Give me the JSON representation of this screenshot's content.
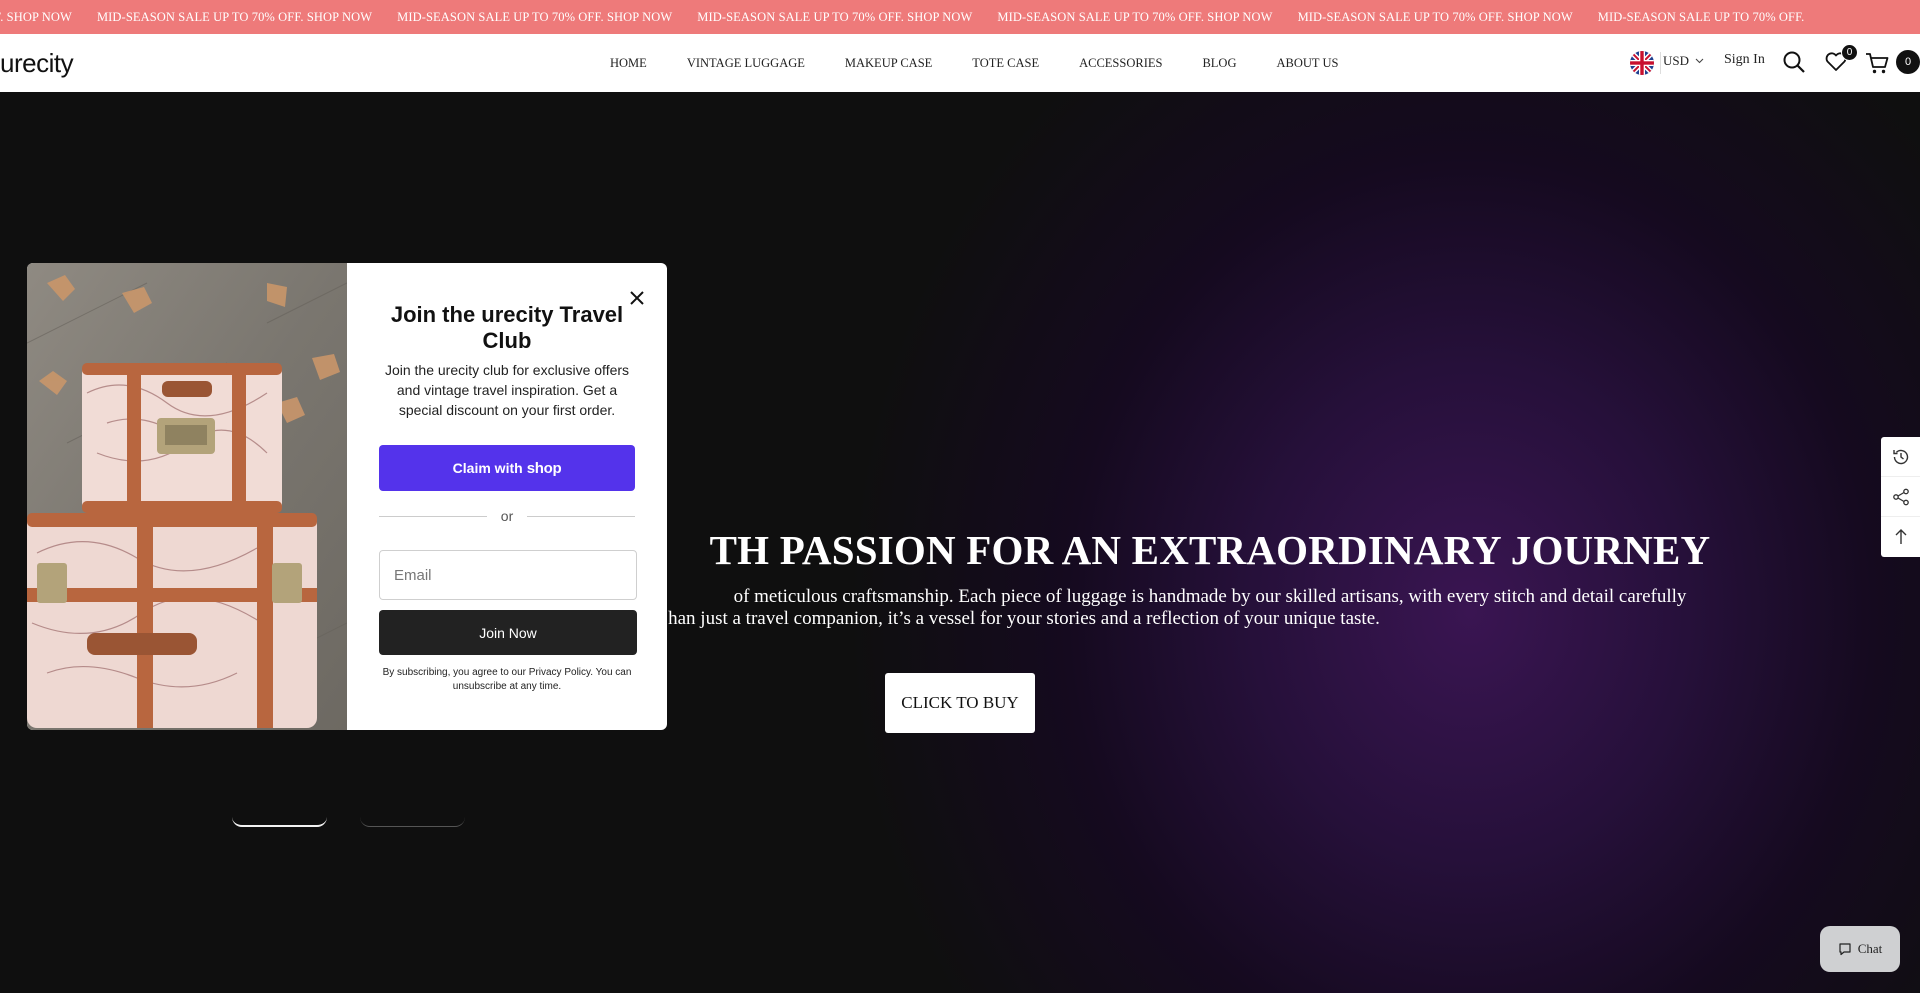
{
  "announcement": {
    "items": [
      "OFF.  SHOP NOW",
      "MID-SEASON SALE UP TO 70% OFF.  SHOP NOW",
      "MID-SEASON SALE UP TO 70% OFF.  SHOP NOW",
      "MID-SEASON SALE UP TO 70% OFF.  SHOP NOW",
      "MID-SEASON SALE UP TO 70% OFF.  SHOP NOW",
      "MID-SEASON SALE UP TO 70% OFF.  SHOP NOW",
      "MID-SEASON SALE UP TO 70% OFF."
    ]
  },
  "header": {
    "logo": "urecity",
    "nav": [
      "HOME",
      "VINTAGE LUGGAGE",
      "MAKEUP CASE",
      "TOTE CASE",
      "ACCESSORIES",
      "BLOG",
      "ABOUT US"
    ],
    "currency": "USD",
    "sign_in": "Sign In",
    "wishlist_count": "0",
    "cart_count": "0"
  },
  "hero": {
    "title": "TH PASSION FOR AN EXTRAORDINARY JOURNEY",
    "desc_line1": "of meticulous craftsmanship. Each piece of luggage is handmade by our skilled artisans, with every stitch and detail carefully",
    "desc_line2": "han just a travel companion, it’s a vessel for your stories and a reflection of your unique taste.",
    "button": "CLICK TO BUY"
  },
  "popup": {
    "title": "Join the urecity Travel Club",
    "text": "Join the urecity club for exclusive offers and vintage travel inspiration. Get a special discount on your first order.",
    "shop_button_prefix": "Claim with",
    "shop_button_brand": "shop",
    "or": "or",
    "email_placeholder": "Email",
    "join_button": "Join Now",
    "legal": "By subscribing, you agree to our Privacy Policy. You can unsubscribe at any time."
  },
  "chat": {
    "label": "Chat"
  },
  "colors": {
    "announcement_bg": "#ee7a7a",
    "shop_pay": "#5433eb",
    "join_button": "#222222"
  }
}
